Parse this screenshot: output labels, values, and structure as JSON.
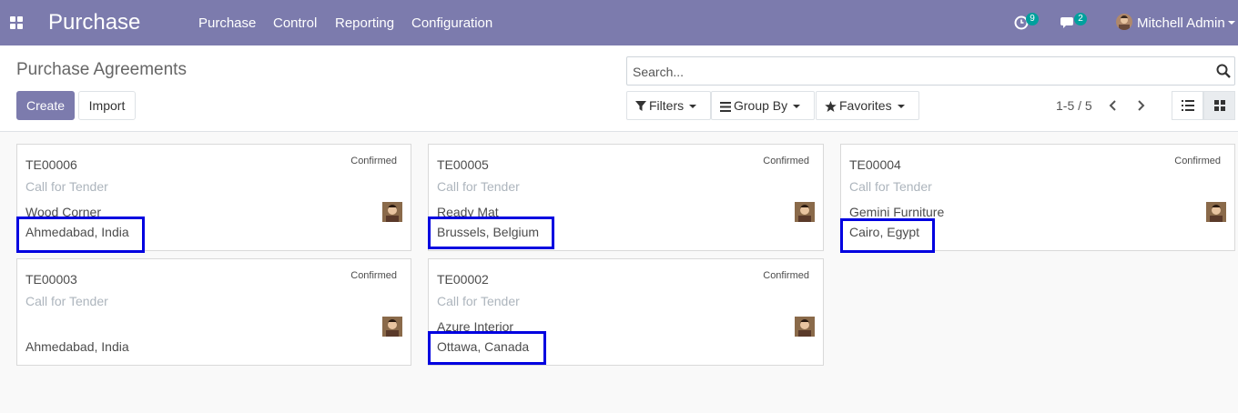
{
  "navbar": {
    "app_title": "Purchase",
    "menu": [
      "Purchase",
      "Control",
      "Reporting",
      "Configuration"
    ],
    "activity_count": "9",
    "message_count": "2",
    "user_name": "Mitchell Admin"
  },
  "control_panel": {
    "title": "Purchase Agreements",
    "create_label": "Create",
    "import_label": "Import",
    "search_placeholder": "Search...",
    "filters_label": "Filters",
    "group_by_label": "Group By",
    "favorites_label": "Favorites",
    "pager": "1-5 / 5"
  },
  "cards": [
    {
      "ref": "TE00006",
      "status": "Confirmed",
      "type": "Call for Tender",
      "vendor": "Wood Corner",
      "city": "Ahmedabad, India",
      "highlighted": true
    },
    {
      "ref": "TE00005",
      "status": "Confirmed",
      "type": "Call for Tender",
      "vendor": "Ready Mat",
      "city": "Brussels, Belgium",
      "highlighted": true
    },
    {
      "ref": "TE00004",
      "status": "Confirmed",
      "type": "Call for Tender",
      "vendor": "Gemini Furniture",
      "city": "Cairo, Egypt",
      "highlighted": true
    },
    {
      "ref": "TE00003",
      "status": "Confirmed",
      "type": "Call for Tender",
      "vendor": "",
      "city": "Ahmedabad, India",
      "highlighted": false
    },
    {
      "ref": "TE00002",
      "status": "Confirmed",
      "type": "Call for Tender",
      "vendor": "Azure Interior",
      "city": "Ottawa, Canada",
      "highlighted": true
    }
  ],
  "colors": {
    "navbar": "#7c7bad",
    "badge": "#00a09d",
    "highlight": "#0000e0"
  }
}
